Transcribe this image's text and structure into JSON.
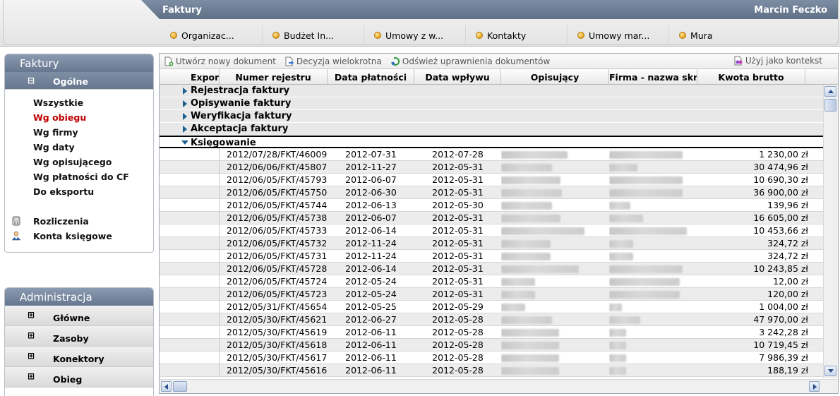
{
  "app_title": "Faktury",
  "user_name": "Marcin Feczko",
  "tabs": [
    {
      "label": "Organizac..."
    },
    {
      "label": "Budżet In..."
    },
    {
      "label": "Umowy z w..."
    },
    {
      "label": "Kontakty"
    },
    {
      "label": "Umowy mar..."
    },
    {
      "label": "Mura"
    }
  ],
  "faktury_panel": {
    "title": "Faktury",
    "section_label": "Ogólne",
    "section_icon": "minus",
    "items": [
      {
        "label": "Wszystkie",
        "selected": false
      },
      {
        "label": "Wg obiegu",
        "selected": true
      },
      {
        "label": "Wg firmy",
        "selected": false
      },
      {
        "label": "Wg daty",
        "selected": false
      },
      {
        "label": "Wg opisującego",
        "selected": false
      },
      {
        "label": "Wg płatności do CF",
        "selected": false
      },
      {
        "label": "Do eksportu",
        "selected": false
      }
    ],
    "extra_items": [
      {
        "label": "Rozliczenia",
        "icon": "calculator-icon"
      },
      {
        "label": "Konta księgowe",
        "icon": "user-icon"
      }
    ]
  },
  "admin_panel": {
    "title": "Administracja",
    "sections": [
      {
        "label": "Główne"
      },
      {
        "label": "Zasoby"
      },
      {
        "label": "Konektory"
      },
      {
        "label": "Obieg"
      }
    ]
  },
  "toolbar": {
    "new_document": "Utwórz nowy dokument",
    "multi_decision": "Decyzja wielokrotna",
    "refresh_permissions": "Odśwież uprawnienia dokumentów",
    "use_as_context": "Użyj jako kontekst"
  },
  "columns": {
    "export": "Export",
    "number": "Numer rejestru",
    "due_date": "Data płatności",
    "received_date": "Data wpływu",
    "describer": "Opisujący",
    "company": "Firma - nazwa skró",
    "gross_amount": "Kwota brutto"
  },
  "groups": [
    {
      "label": "Rejestracja faktury",
      "expanded": false
    },
    {
      "label": "Opisywanie faktury",
      "expanded": false
    },
    {
      "label": "Weryfikacja faktury",
      "expanded": false
    },
    {
      "label": "Akceptacja faktury",
      "expanded": false
    },
    {
      "label": "Księgowanie",
      "expanded": true
    }
  ],
  "rows": [
    {
      "number": "2012/07/28/FKT/46009",
      "due": "2012-07-31",
      "received": "2012-07-28",
      "amount": "1 230,00 zł"
    },
    {
      "number": "2012/06/06/FKT/45807",
      "due": "2012-11-27",
      "received": "2012-05-31",
      "amount": "30 474,96 zł"
    },
    {
      "number": "2012/06/05/FKT/45793",
      "due": "2012-06-07",
      "received": "2012-05-31",
      "amount": "10 690,30 zł"
    },
    {
      "number": "2012/06/05/FKT/45750",
      "due": "2012-06-30",
      "received": "2012-05-31",
      "amount": "36 900,00 zł"
    },
    {
      "number": "2012/06/05/FKT/45744",
      "due": "2012-06-13",
      "received": "2012-05-30",
      "amount": "139,96 zł"
    },
    {
      "number": "2012/06/05/FKT/45738",
      "due": "2012-06-07",
      "received": "2012-05-31",
      "amount": "16 605,00 zł"
    },
    {
      "number": "2012/06/05/FKT/45733",
      "due": "2012-06-14",
      "received": "2012-05-31",
      "amount": "10 453,66 zł"
    },
    {
      "number": "2012/06/05/FKT/45732",
      "due": "2012-11-24",
      "received": "2012-05-31",
      "amount": "324,72 zł"
    },
    {
      "number": "2012/06/05/FKT/45731",
      "due": "2012-11-24",
      "received": "2012-05-31",
      "amount": "324,72 zł"
    },
    {
      "number": "2012/06/05/FKT/45728",
      "due": "2012-06-14",
      "received": "2012-05-31",
      "amount": "10 243,85 zł"
    },
    {
      "number": "2012/06/05/FKT/45724",
      "due": "2012-05-24",
      "received": "2012-05-31",
      "amount": "12,00 zł"
    },
    {
      "number": "2012/06/05/FKT/45723",
      "due": "2012-05-24",
      "received": "2012-05-31",
      "amount": "120,00 zł"
    },
    {
      "number": "2012/05/31/FKT/45654",
      "due": "2012-05-25",
      "received": "2012-05-29",
      "amount": "1 004,00 zł"
    },
    {
      "number": "2012/05/30/FKT/45621",
      "due": "2012-06-27",
      "received": "2012-05-28",
      "amount": "47 970,00 zł"
    },
    {
      "number": "2012/05/30/FKT/45619",
      "due": "2012-06-11",
      "received": "2012-05-28",
      "amount": "3 242,28 zł"
    },
    {
      "number": "2012/05/30/FKT/45618",
      "due": "2012-06-11",
      "received": "2012-05-28",
      "amount": "10 719,45 zł"
    },
    {
      "number": "2012/05/30/FKT/45617",
      "due": "2012-06-11",
      "received": "2012-05-28",
      "amount": "7 986,39 zł"
    },
    {
      "number": "2012/05/30/FKT/45616",
      "due": "2012-06-11",
      "received": "2012-05-28",
      "amount": "188,19 zł"
    }
  ],
  "colors": {
    "header_blue": "#66778f",
    "selected_nav": "#c00000",
    "caret": "#1a5f8f"
  }
}
